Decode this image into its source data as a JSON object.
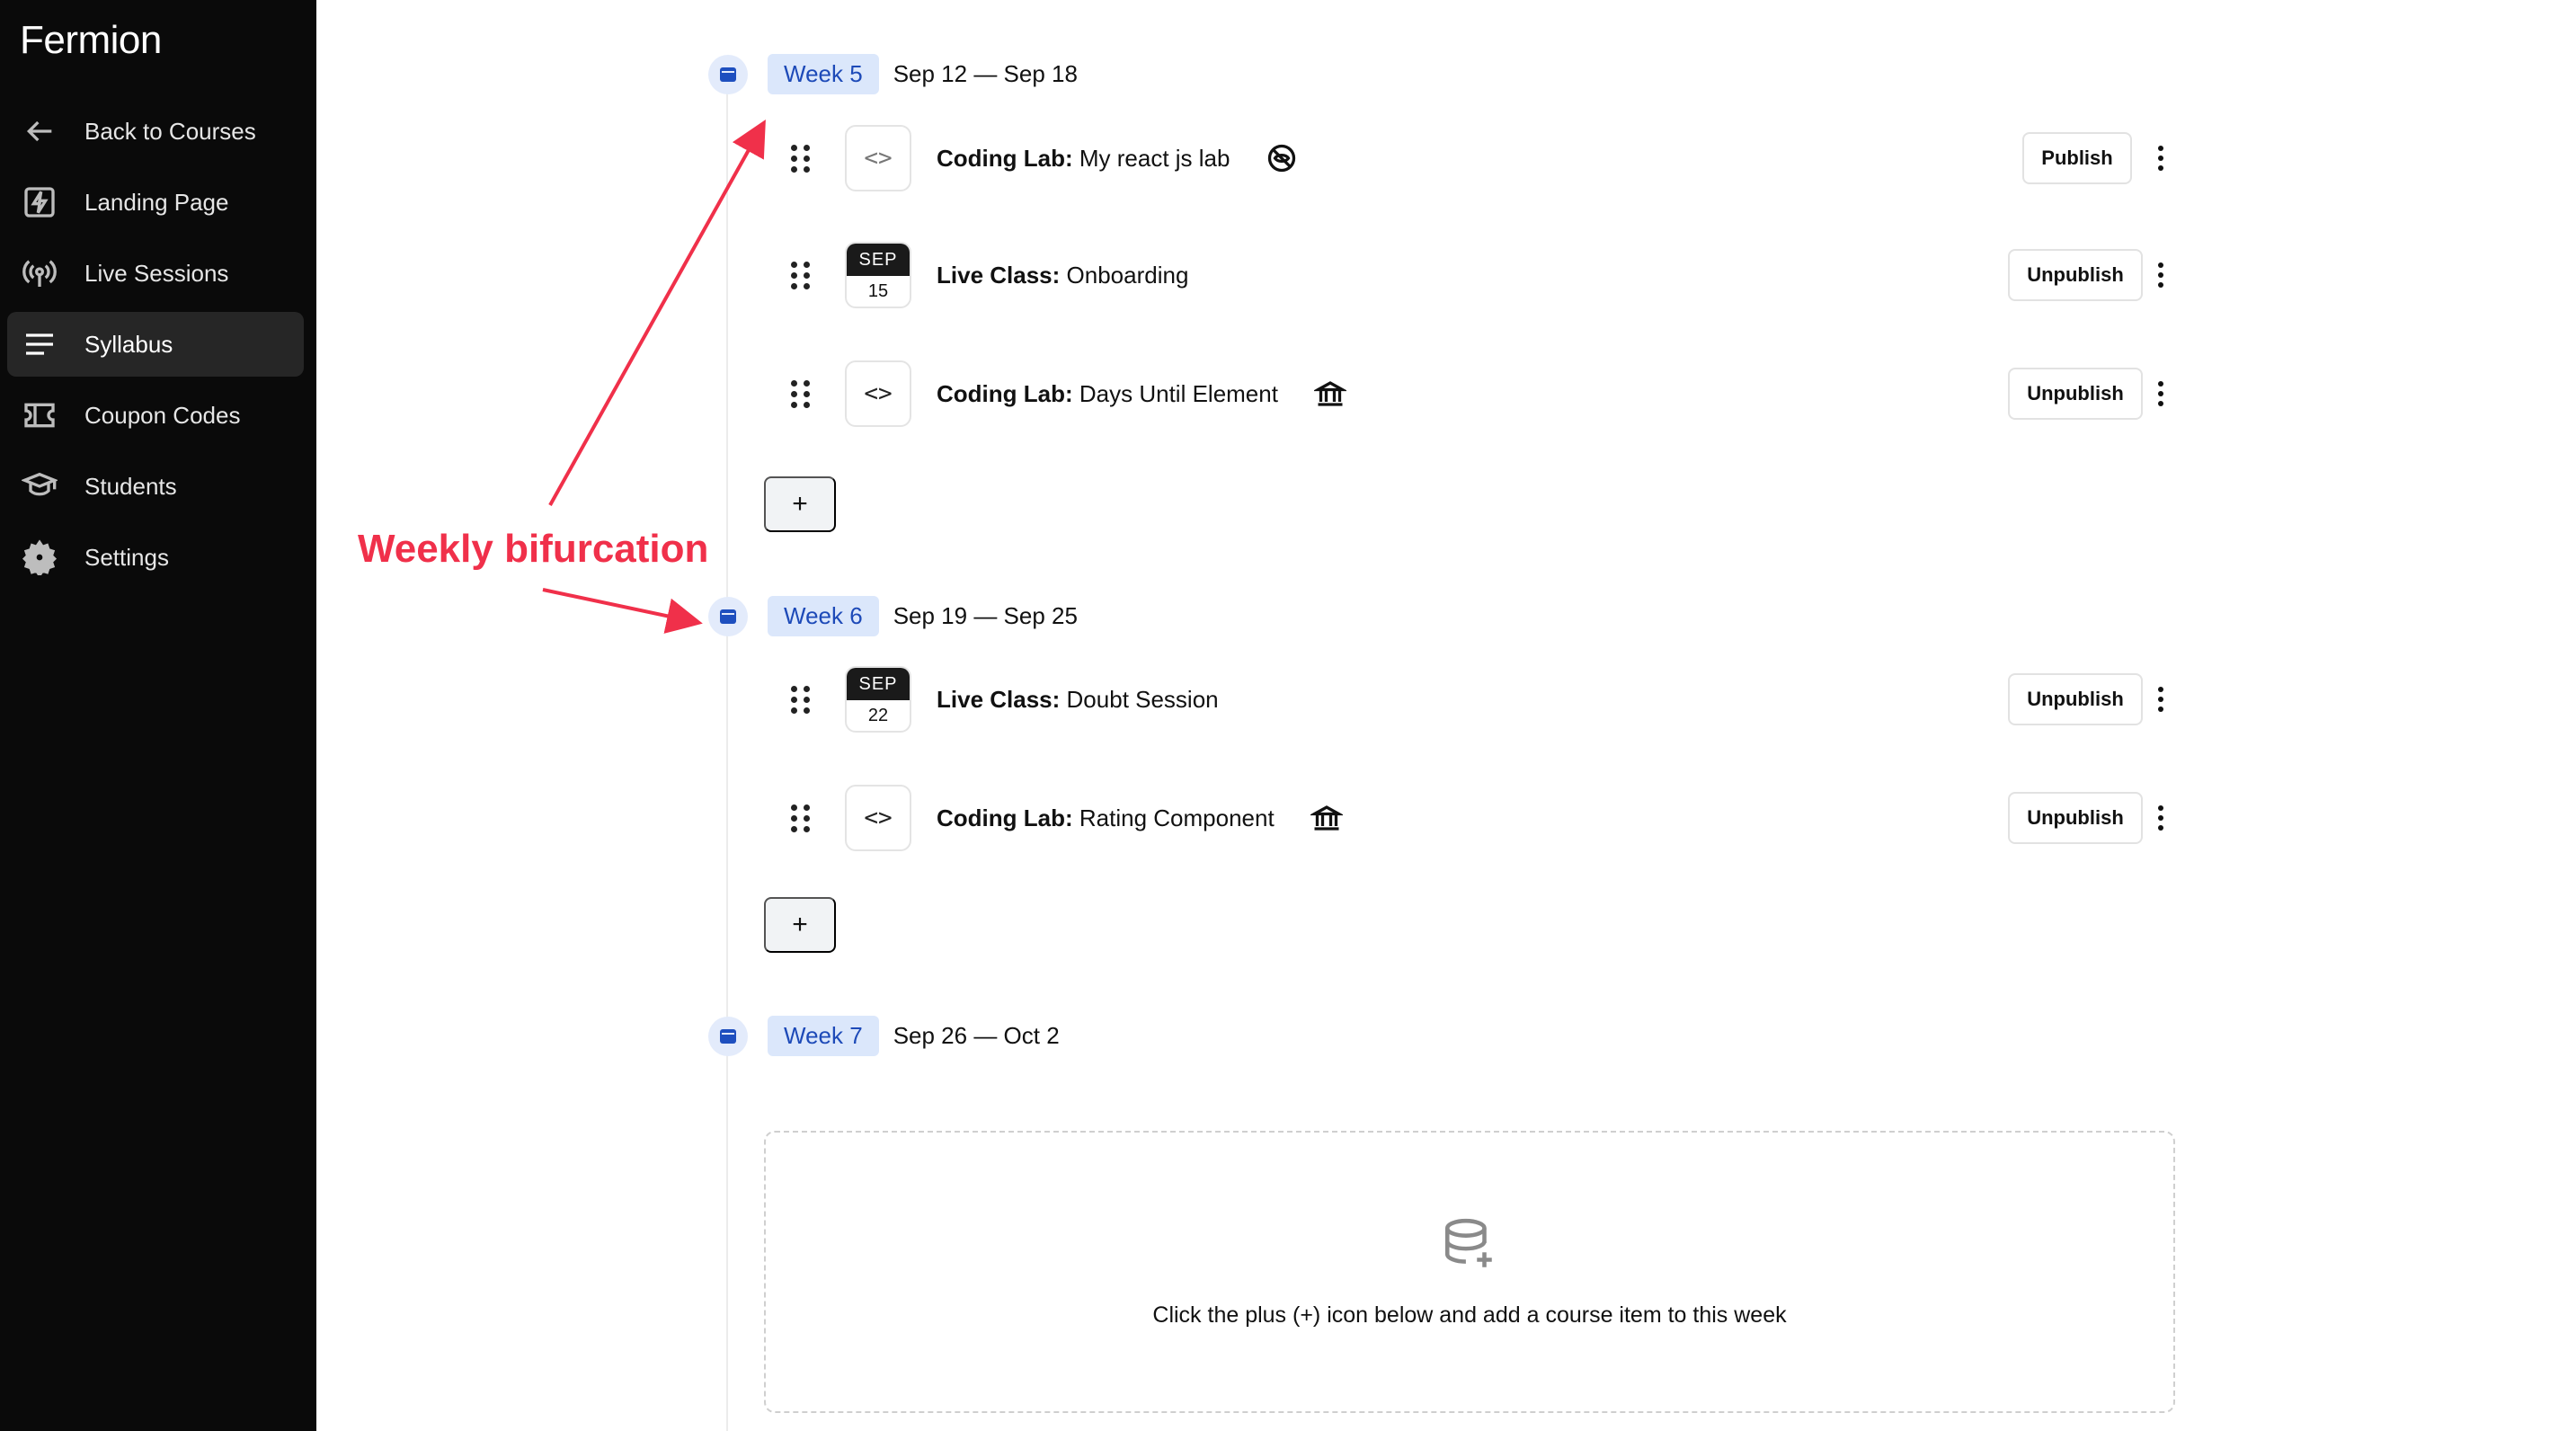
{
  "app": {
    "brand": "Fermion"
  },
  "sidebar": {
    "items": [
      {
        "label": "Back to Courses",
        "icon": "arrow-left-icon"
      },
      {
        "label": "Landing Page",
        "icon": "lightning-icon"
      },
      {
        "label": "Live Sessions",
        "icon": "broadcast-icon"
      },
      {
        "label": "Syllabus",
        "icon": "lines-icon",
        "active": true
      },
      {
        "label": "Coupon Codes",
        "icon": "ticket-icon"
      },
      {
        "label": "Students",
        "icon": "graduation-icon"
      },
      {
        "label": "Settings",
        "icon": "gear-icon"
      }
    ]
  },
  "weeks": [
    {
      "badge": "Week 5",
      "range": "Sep 12 — Sep 18",
      "items": [
        {
          "type_label": "Coding Lab:",
          "title": "My react js lab",
          "kind": "code",
          "state_icon": "eye-off-icon",
          "button": "Publish"
        },
        {
          "type_label": "Live Class:",
          "title": "Onboarding",
          "kind": "date",
          "month": "SEP",
          "day": "15",
          "button": "Unpublish"
        },
        {
          "type_label": "Coding Lab:",
          "title": "Days Until Element",
          "kind": "code",
          "state_icon": "bank-icon",
          "button": "Unpublish"
        }
      ],
      "add_label": "+"
    },
    {
      "badge": "Week 6",
      "range": "Sep 19 — Sep 25",
      "items": [
        {
          "type_label": "Live Class:",
          "title": "Doubt Session",
          "kind": "date",
          "month": "SEP",
          "day": "22",
          "button": "Unpublish"
        },
        {
          "type_label": "Coding Lab:",
          "title": "Rating Component",
          "kind": "code",
          "state_icon": "bank-icon",
          "button": "Unpublish"
        }
      ],
      "add_label": "+"
    },
    {
      "badge": "Week 7",
      "range": "Sep 26 — Oct 2",
      "empty_text": "Click the plus (+) icon below and add a course item to this week"
    }
  ],
  "annotation": {
    "text": "Weekly bifurcation",
    "color": "#f0304a"
  },
  "code_glyph": "<>",
  "colors": {
    "sidebar_bg": "#0a0a0a",
    "week_badge_bg": "#dbe7fb",
    "week_badge_text": "#1d4ab8"
  }
}
